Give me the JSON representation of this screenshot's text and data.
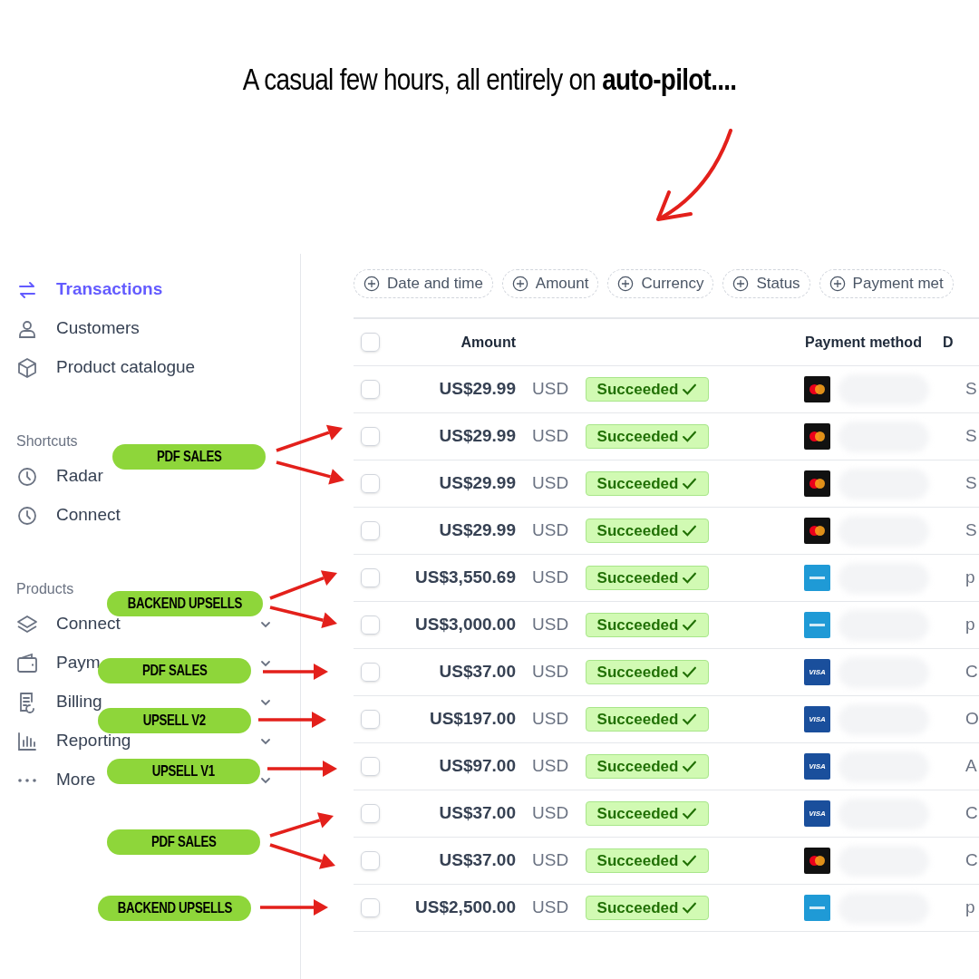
{
  "headline": "A casual few hours, all entirely on **auto-pilot....**",
  "sidebar": {
    "groups": [
      {
        "items": [
          {
            "label": "Transactions",
            "selected": true
          },
          {
            "label": "Customers",
            "selected": false
          },
          {
            "label": "Product catalogue",
            "selected": false
          }
        ]
      },
      {
        "heading": "Shortcuts",
        "items": [
          {
            "label": "Radar",
            "selected": false
          },
          {
            "label": "Connect",
            "selected": false
          }
        ]
      },
      {
        "heading": "Products",
        "items": [
          {
            "label": "Connect",
            "selected": false,
            "expandable": true
          },
          {
            "label": "Paym",
            "selected": false,
            "expandable": true
          },
          {
            "label": "Billing",
            "selected": false,
            "expandable": true
          },
          {
            "label": "Reporting",
            "selected": false,
            "expandable": true
          },
          {
            "label": "More",
            "selected": false,
            "expandable": true
          }
        ]
      }
    ]
  },
  "filters": [
    "Date and time",
    "Amount",
    "Currency",
    "Status",
    "Payment met"
  ],
  "table": {
    "header_checked": false,
    "columns": {
      "amount": "Amount",
      "payment_method": "Payment method",
      "column_5": "D"
    },
    "rows": [
      {
        "amount": "US$29.99",
        "currency": "USD",
        "status": "Succeeded",
        "kind": "mastercard",
        "column_5": "S",
        "checked": false
      },
      {
        "amount": "US$29.99",
        "currency": "USD",
        "status": "Succeeded",
        "kind": "mastercard",
        "column_5": "S",
        "checked": false
      },
      {
        "amount": "US$29.99",
        "currency": "USD",
        "status": "Succeeded",
        "kind": "mastercard",
        "column_5": "S",
        "checked": false
      },
      {
        "amount": "US$29.99",
        "currency": "USD",
        "status": "Succeeded",
        "kind": "mastercard",
        "column_5": "S",
        "checked": false
      },
      {
        "amount": "US$3,550.69",
        "currency": "USD",
        "status": "Succeeded",
        "kind": "amex",
        "column_5": "p",
        "checked": false
      },
      {
        "amount": "US$3,000.00",
        "currency": "USD",
        "status": "Succeeded",
        "kind": "amex",
        "column_5": "p",
        "checked": false
      },
      {
        "amount": "US$37.00",
        "currency": "USD",
        "status": "Succeeded",
        "kind": "visa",
        "card_label": "VISA",
        "column_5": "C",
        "checked": false
      },
      {
        "amount": "US$197.00",
        "currency": "USD",
        "status": "Succeeded",
        "kind": "visa",
        "card_label": "VISA",
        "column_5": "O",
        "checked": false
      },
      {
        "amount": "US$97.00",
        "currency": "USD",
        "status": "Succeeded",
        "kind": "visa",
        "card_label": "VISA",
        "column_5": "A",
        "checked": false
      },
      {
        "amount": "US$37.00",
        "currency": "USD",
        "status": "Succeeded",
        "kind": "visa",
        "card_label": "VISA",
        "column_5": "C",
        "checked": false
      },
      {
        "amount": "US$37.00",
        "currency": "USD",
        "status": "Succeeded",
        "kind": "mastercard",
        "column_5": "C",
        "checked": false
      },
      {
        "amount": "US$2,500.00",
        "currency": "USD",
        "status": "Succeeded",
        "kind": "amex",
        "column_5": "p",
        "checked": false
      }
    ]
  },
  "annotations": [
    "PDF SALES",
    "BACKEND UPSELLS",
    "PDF SALES",
    "UPSELL V2",
    "UPSELL V1",
    "PDF SALES",
    "BACKEND UPSELLS"
  ]
}
